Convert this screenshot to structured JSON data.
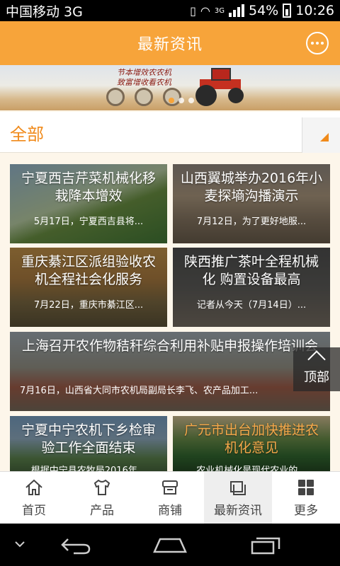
{
  "status_bar": {
    "carrier": "中国移动 3G",
    "network": "3G",
    "battery": "54%",
    "time": "10:26"
  },
  "header": {
    "title": "最新资讯",
    "message_icon": "chat-bubble-icon"
  },
  "banner": {
    "slogan_line1": "节本增效农农机",
    "slogan_line2": "致富增收看农机",
    "slides": 3,
    "active_slide": 1
  },
  "category": {
    "selected": "全部"
  },
  "news": [
    {
      "title": "宁夏西吉芹菜机械化移栽降本增效",
      "summary": "5月17日，宁夏西吉县将..."
    },
    {
      "title": "山西翼城举办2016年小麦探墒沟播演示",
      "summary": "7月12日，为了更好地服..."
    },
    {
      "title": "重庆綦江区派组验收农机全程社会化服务",
      "summary": "7月22日，重庆市綦江区..."
    },
    {
      "title": "陕西推广茶叶全程机械化 购置设备最高",
      "summary": "记者从今天（7月14日）..."
    },
    {
      "title": "上海召开农作物秸秆综合利用补贴申报操作培训会",
      "summary": "7月16日，山西省大同市农机局副局长李飞、农产品加工..."
    },
    {
      "title": "宁夏中宁农机下乡检审验工作全面结束",
      "summary": "根据中宁县农牧局2016年..."
    },
    {
      "title": "广元市出台加快推进农机化意见",
      "summary": "农业机械化是现代农业的..."
    }
  ],
  "back_to_top": {
    "label": "顶部"
  },
  "nav": {
    "items": [
      {
        "label": "首页",
        "icon": "home-icon"
      },
      {
        "label": "产品",
        "icon": "shirt-icon"
      },
      {
        "label": "商铺",
        "icon": "shop-icon"
      },
      {
        "label": "最新资讯",
        "icon": "news-icon"
      },
      {
        "label": "更多",
        "icon": "grid-icon"
      }
    ],
    "active": "最新资讯"
  },
  "colors": {
    "accent": "#f7a43a",
    "category_text": "#f08a1a"
  }
}
